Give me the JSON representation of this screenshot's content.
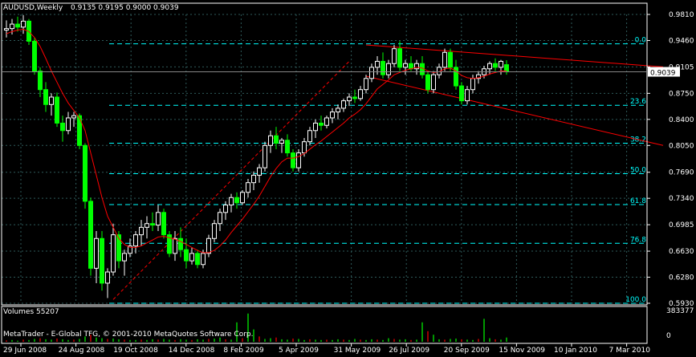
{
  "header": {
    "symbol_title": "AUDUSD,Weekly",
    "ohlc": "0.9135 0.9195 0.9000 0.9039"
  },
  "volume_panel": {
    "label": "Volumes 55207",
    "max_label": "383377",
    "zero_label": "0"
  },
  "watermark": "MetaTrader - E-Global TFG, © 2001-2010 MetaQuotes Software Corp.",
  "price_axis": {
    "ticks": [
      "0.9810",
      "0.9460",
      "0.9105",
      "0.8750",
      "0.8400",
      "0.8050",
      "0.7690",
      "0.7340",
      "0.6985",
      "0.6630",
      "0.6280",
      "0.5930"
    ],
    "current_price": "0.9039"
  },
  "time_axis": {
    "labels": [
      "29 Jun 2008",
      "24 Aug 2008",
      "19 Oct 2008",
      "14 Dec 2008",
      "8 Feb 2009",
      "5 Apr 2009",
      "31 May 2009",
      "26 Jul 2009",
      "20 Sep 2009",
      "15 Nov 2009",
      "10 Jan 2010",
      "7 Mar 2010"
    ]
  },
  "fibonacci": {
    "levels": [
      "0.0",
      "23.6",
      "38.2",
      "50.0",
      "61.8",
      "76.8",
      "100.0"
    ]
  },
  "colors": {
    "background": "#000000",
    "bull_candle": "#ffffff",
    "bear_candle": "#00ff00",
    "fib_lines": "#00ffff",
    "moving_average": "#ff0000",
    "trendlines": "#ff0000",
    "grid": "#2e5a5a",
    "volume_bars": "#00ff00"
  },
  "chart_data": {
    "type": "candlestick",
    "x_unit": "week",
    "ylim": [
      0.593,
      0.981
    ],
    "candles": [
      [
        0.96,
        0.973,
        0.95,
        0.962
      ],
      [
        0.962,
        0.975,
        0.954,
        0.968
      ],
      [
        0.968,
        0.978,
        0.958,
        0.964
      ],
      [
        0.964,
        0.98,
        0.955,
        0.972
      ],
      [
        0.972,
        0.975,
        0.94,
        0.945
      ],
      [
        0.945,
        0.95,
        0.9,
        0.905
      ],
      [
        0.905,
        0.91,
        0.87,
        0.88
      ],
      [
        0.88,
        0.89,
        0.85,
        0.86
      ],
      [
        0.86,
        0.875,
        0.845,
        0.87
      ],
      [
        0.87,
        0.876,
        0.83,
        0.835
      ],
      [
        0.835,
        0.845,
        0.81,
        0.825
      ],
      [
        0.825,
        0.85,
        0.82,
        0.842
      ],
      [
        0.842,
        0.85,
        0.83,
        0.845
      ],
      [
        0.845,
        0.848,
        0.8,
        0.805
      ],
      [
        0.805,
        0.808,
        0.72,
        0.73
      ],
      [
        0.73,
        0.735,
        0.63,
        0.64
      ],
      [
        0.64,
        0.69,
        0.62,
        0.68
      ],
      [
        0.68,
        0.69,
        0.61,
        0.62
      ],
      [
        0.62,
        0.64,
        0.6,
        0.635
      ],
      [
        0.635,
        0.7,
        0.63,
        0.685
      ],
      [
        0.685,
        0.69,
        0.64,
        0.65
      ],
      [
        0.65,
        0.665,
        0.63,
        0.66
      ],
      [
        0.66,
        0.68,
        0.655,
        0.67
      ],
      [
        0.67,
        0.69,
        0.66,
        0.685
      ],
      [
        0.685,
        0.705,
        0.67,
        0.695
      ],
      [
        0.695,
        0.71,
        0.68,
        0.7
      ],
      [
        0.7,
        0.715,
        0.69,
        0.698
      ],
      [
        0.698,
        0.725,
        0.69,
        0.715
      ],
      [
        0.715,
        0.72,
        0.68,
        0.685
      ],
      [
        0.685,
        0.69,
        0.655,
        0.66
      ],
      [
        0.66,
        0.69,
        0.65,
        0.68
      ],
      [
        0.68,
        0.695,
        0.655,
        0.665
      ],
      [
        0.665,
        0.68,
        0.64,
        0.65
      ],
      [
        0.65,
        0.668,
        0.645,
        0.66
      ],
      [
        0.66,
        0.665,
        0.64,
        0.645
      ],
      [
        0.645,
        0.665,
        0.64,
        0.66
      ],
      [
        0.66,
        0.685,
        0.655,
        0.68
      ],
      [
        0.68,
        0.705,
        0.675,
        0.7
      ],
      [
        0.7,
        0.72,
        0.69,
        0.715
      ],
      [
        0.715,
        0.73,
        0.705,
        0.725
      ],
      [
        0.725,
        0.74,
        0.715,
        0.735
      ],
      [
        0.735,
        0.742,
        0.72,
        0.728
      ],
      [
        0.728,
        0.745,
        0.725,
        0.742
      ],
      [
        0.742,
        0.76,
        0.735,
        0.755
      ],
      [
        0.755,
        0.77,
        0.745,
        0.765
      ],
      [
        0.765,
        0.78,
        0.755,
        0.775
      ],
      [
        0.775,
        0.81,
        0.77,
        0.805
      ],
      [
        0.805,
        0.825,
        0.795,
        0.818
      ],
      [
        0.818,
        0.83,
        0.8,
        0.808
      ],
      [
        0.808,
        0.815,
        0.795,
        0.812
      ],
      [
        0.812,
        0.82,
        0.79,
        0.795
      ],
      [
        0.795,
        0.8,
        0.77,
        0.775
      ],
      [
        0.775,
        0.8,
        0.77,
        0.795
      ],
      [
        0.795,
        0.815,
        0.79,
        0.81
      ],
      [
        0.81,
        0.83,
        0.805,
        0.825
      ],
      [
        0.825,
        0.84,
        0.815,
        0.835
      ],
      [
        0.835,
        0.845,
        0.825,
        0.832
      ],
      [
        0.832,
        0.845,
        0.828,
        0.842
      ],
      [
        0.842,
        0.855,
        0.835,
        0.85
      ],
      [
        0.85,
        0.86,
        0.84,
        0.855
      ],
      [
        0.855,
        0.868,
        0.85,
        0.865
      ],
      [
        0.865,
        0.875,
        0.858,
        0.87
      ],
      [
        0.87,
        0.88,
        0.862,
        0.868
      ],
      [
        0.868,
        0.885,
        0.865,
        0.88
      ],
      [
        0.88,
        0.9,
        0.875,
        0.895
      ],
      [
        0.895,
        0.915,
        0.89,
        0.91
      ],
      [
        0.91,
        0.925,
        0.9,
        0.918
      ],
      [
        0.918,
        0.93,
        0.895,
        0.9
      ],
      [
        0.9,
        0.92,
        0.895,
        0.915
      ],
      [
        0.915,
        0.94,
        0.91,
        0.935
      ],
      [
        0.935,
        0.945,
        0.905,
        0.91
      ],
      [
        0.91,
        0.92,
        0.9,
        0.915
      ],
      [
        0.915,
        0.925,
        0.905,
        0.908
      ],
      [
        0.908,
        0.92,
        0.9,
        0.915
      ],
      [
        0.915,
        0.925,
        0.895,
        0.9
      ],
      [
        0.9,
        0.905,
        0.875,
        0.88
      ],
      [
        0.88,
        0.905,
        0.875,
        0.9
      ],
      [
        0.9,
        0.915,
        0.895,
        0.91
      ],
      [
        0.91,
        0.935,
        0.905,
        0.93
      ],
      [
        0.93,
        0.935,
        0.905,
        0.91
      ],
      [
        0.91,
        0.92,
        0.88,
        0.885
      ],
      [
        0.885,
        0.89,
        0.86,
        0.865
      ],
      [
        0.865,
        0.885,
        0.86,
        0.88
      ],
      [
        0.88,
        0.9,
        0.875,
        0.895
      ],
      [
        0.895,
        0.905,
        0.888,
        0.9
      ],
      [
        0.9,
        0.912,
        0.895,
        0.908
      ],
      [
        0.908,
        0.918,
        0.9,
        0.915
      ],
      [
        0.915,
        0.922,
        0.905,
        0.91
      ],
      [
        0.91,
        0.92,
        0.9,
        0.918
      ],
      [
        0.9135,
        0.9195,
        0.9,
        0.9039
      ]
    ],
    "moving_average": [
      0.955,
      0.958,
      0.96,
      0.961,
      0.958,
      0.95,
      0.938,
      0.922,
      0.905,
      0.89,
      0.875,
      0.862,
      0.852,
      0.842,
      0.825,
      0.795,
      0.765,
      0.735,
      0.71,
      0.695,
      0.68,
      0.672,
      0.668,
      0.668,
      0.67,
      0.674,
      0.678,
      0.682,
      0.683,
      0.681,
      0.679,
      0.676,
      0.672,
      0.668,
      0.664,
      0.661,
      0.661,
      0.664,
      0.67,
      0.678,
      0.688,
      0.697,
      0.706,
      0.716,
      0.726,
      0.737,
      0.75,
      0.763,
      0.774,
      0.783,
      0.788,
      0.788,
      0.79,
      0.794,
      0.8,
      0.806,
      0.811,
      0.817,
      0.823,
      0.829,
      0.835,
      0.842,
      0.847,
      0.853,
      0.861,
      0.871,
      0.881,
      0.887,
      0.893,
      0.9,
      0.903,
      0.906,
      0.908,
      0.91,
      0.909,
      0.905,
      0.903,
      0.904,
      0.908,
      0.909,
      0.905,
      0.899,
      0.896,
      0.895,
      0.896,
      0.898,
      0.901,
      0.903,
      0.905,
      0.905
    ],
    "volumes": [
      0.04,
      0.05,
      0.03,
      0.06,
      0.05,
      0.08,
      0.1,
      0.07,
      0.06,
      0.09,
      0.07,
      0.05,
      0.06,
      0.08,
      0.15,
      0.2,
      0.12,
      0.1,
      0.08,
      0.09,
      0.07,
      0.06,
      0.05,
      0.05,
      0.06,
      0.05,
      0.07,
      0.06,
      0.08,
      0.06,
      0.05,
      0.07,
      0.06,
      0.05,
      0.07,
      0.06,
      0.08,
      0.09,
      0.12,
      0.07,
      0.06,
      0.55,
      0.1,
      0.8,
      0.35,
      0.15,
      0.08,
      0.1,
      0.12,
      0.07,
      0.06,
      0.09,
      0.08,
      0.05,
      0.07,
      0.06,
      0.05,
      0.06,
      0.05,
      0.07,
      0.06,
      0.05,
      0.08,
      0.06,
      0.05,
      0.07,
      0.06,
      0.05,
      0.1,
      0.08,
      0.06,
      0.07,
      0.05,
      0.06,
      0.55,
      0.3,
      0.2,
      0.07,
      0.06,
      0.08,
      0.09,
      0.07,
      0.06,
      0.05,
      0.08,
      0.65,
      0.1,
      0.07,
      0.06,
      0.12
    ],
    "volume_max": 383377,
    "fib_levels": [
      {
        "label": "0.0",
        "price": 0.9415
      },
      {
        "label": "23.6",
        "price": 0.859
      },
      {
        "label": "38.2",
        "price": 0.808
      },
      {
        "label": "50.0",
        "price": 0.767
      },
      {
        "label": "61.8",
        "price": 0.7255
      },
      {
        "label": "76.8",
        "price": 0.6735
      },
      {
        "label": "100.0",
        "price": 0.593
      }
    ],
    "trendlines": [
      {
        "from": [
          64,
          0.94
        ],
        "to": [
          89.5,
          0.918
        ],
        "extend_price": 0.9105
      },
      {
        "from": [
          64,
          0.898
        ],
        "to": [
          89.5,
          0.84
        ],
        "extend_price": 0.805
      }
    ],
    "channel_line": {
      "from": [
        19,
        0.598
      ],
      "to": [
        61,
        0.918
      ]
    }
  }
}
